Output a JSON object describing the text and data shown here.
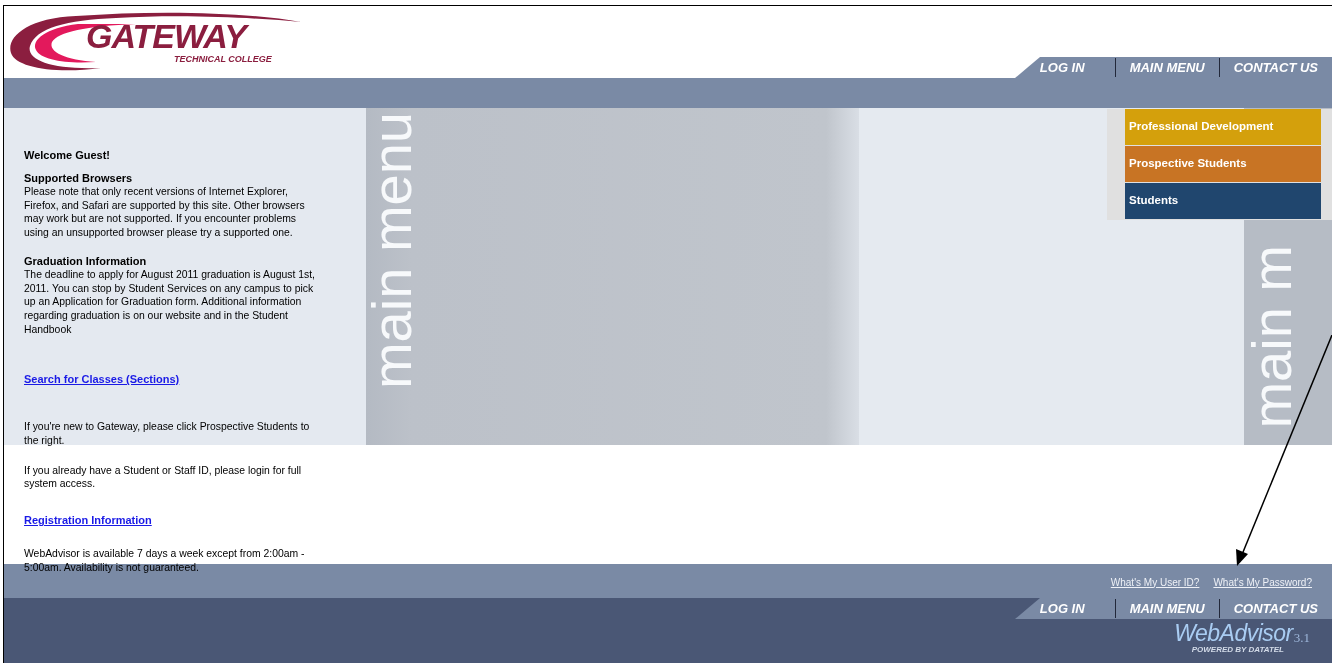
{
  "header": {
    "logo": {
      "name": "GATEWAY",
      "subtitle": "TECHNICAL COLLEGE"
    },
    "nav": [
      {
        "label": "LOG IN"
      },
      {
        "label": "MAIN MENU"
      },
      {
        "label": "CONTACT US"
      }
    ]
  },
  "banner": {
    "watermarks": [
      "main menu",
      "main m"
    ]
  },
  "menu": [
    {
      "label": "Professional Development",
      "color": "#d4a00c"
    },
    {
      "label": "Prospective Students",
      "color": "#c87424"
    },
    {
      "label": "Students",
      "color": "#20466e"
    }
  ],
  "content": [
    {
      "kind": "title",
      "text": "Welcome Guest!"
    },
    {
      "kind": "section",
      "heading": "Supported Browsers",
      "text": "Please note that only recent versions of Internet Explorer, Firefox, and Safari are supported by this site. Other browsers may work but are not supported. If you encounter problems using an unsupported browser please try a supported one."
    },
    {
      "kind": "section",
      "heading": "Graduation Information",
      "text": "The deadline to apply for August 2011 graduation is August 1st, 2011. You can stop by Student Services on any campus to pick up an Application for Graduation form. Additional information regarding graduation is on our website and in the Student Handbook"
    },
    {
      "kind": "link",
      "text": "Search for Classes (Sections)"
    },
    {
      "kind": "paragraph",
      "text": "If you're new to Gateway, please click Prospective Students to the right."
    },
    {
      "kind": "paragraph",
      "text": "If you already have a Student or Staff ID, please login for full system access."
    },
    {
      "kind": "link",
      "text": "Registration Information"
    },
    {
      "kind": "paragraph",
      "text": "WebAdvisor is available 7 days a week except from 2:00am - 5:00am. Availability is not guaranteed."
    }
  ],
  "footer": {
    "links": [
      "What's My User ID?",
      "What's My Password?"
    ],
    "nav": [
      {
        "label": "LOG IN"
      },
      {
        "label": "MAIN MENU"
      },
      {
        "label": "CONTACT US"
      }
    ],
    "brand": {
      "name": "WebAdvisor",
      "version": "3.1",
      "tagline": "POWERED BY DATATEL"
    }
  }
}
